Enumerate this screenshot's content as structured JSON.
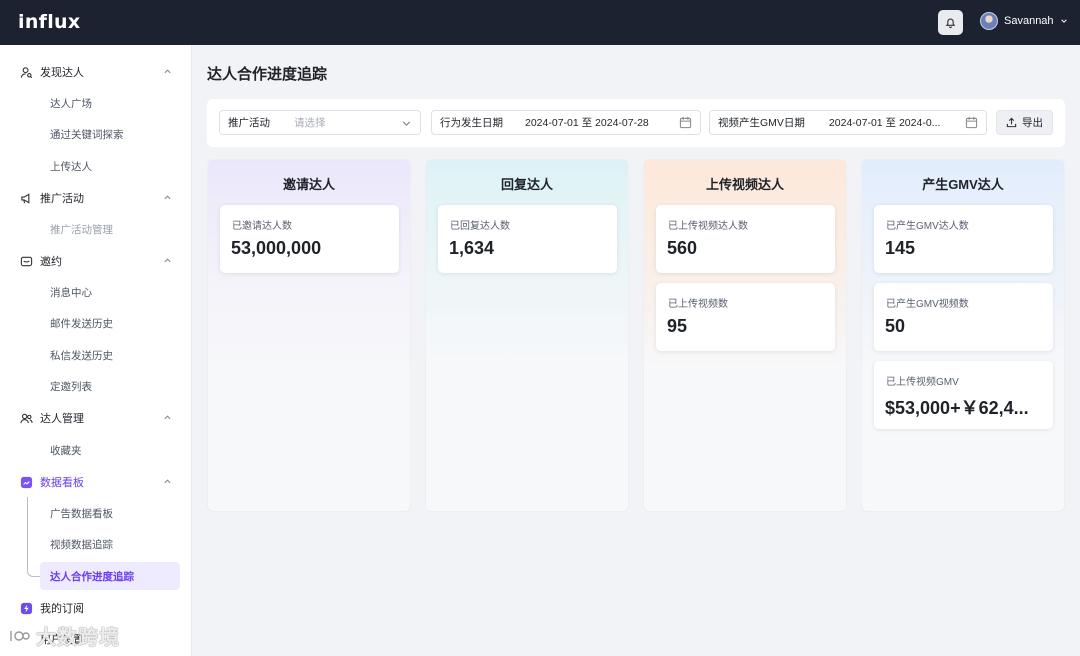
{
  "app": {
    "logo": "influx"
  },
  "header": {
    "user_name": "Savannah"
  },
  "sidebar": {
    "groups": [
      {
        "label": "发现达人",
        "items": [
          "达人广场",
          "通过关键词探索",
          "上传达人"
        ]
      },
      {
        "label": "推广活动",
        "items": [
          "推广活动管理"
        ]
      },
      {
        "label": "邀约",
        "items": [
          "消息中心",
          "邮件发送历史",
          "私信发送历史",
          "定邀列表"
        ]
      },
      {
        "label": "达人管理",
        "items": [
          "收藏夹"
        ]
      },
      {
        "label": "数据看板",
        "items": [
          "广告数据看板",
          "视频数据追踪",
          "达人合作进度追踪"
        ]
      },
      {
        "label": "我的订阅",
        "items": []
      },
      {
        "label": "用户设置",
        "items": []
      }
    ],
    "watermark": "大数跨境"
  },
  "main": {
    "title": "达人合作进度追踪",
    "filters": {
      "campaign_label": "推广活动",
      "campaign_placeholder": "请选择",
      "action_date_label": "行为发生日期",
      "action_date_value": "2024-07-01 至 2024-07-28",
      "gmv_date_label": "视频产生GMV日期",
      "gmv_date_value": "2024-07-01 至 2024-0...",
      "export_label": "导出"
    },
    "columns": [
      {
        "title": "邀请达人",
        "cards": [
          {
            "label": "已邀请达人数",
            "value": "53,000,000"
          }
        ]
      },
      {
        "title": "回复达人",
        "cards": [
          {
            "label": "已回复达人数",
            "value": "1,634"
          }
        ]
      },
      {
        "title": "上传视频达人",
        "cards": [
          {
            "label": "已上传视频达人数",
            "value": "560"
          },
          {
            "label": "已上传视频数",
            "value": "95"
          }
        ]
      },
      {
        "title": "产生GMV达人",
        "cards": [
          {
            "label": "已产生GMV达人数",
            "value": "145"
          },
          {
            "label": "已产生GMV视频数",
            "value": "50"
          },
          {
            "label": "已上传视频GMV",
            "value": "$53,000+￥62,4..."
          }
        ]
      }
    ]
  },
  "colors": {
    "accent": "#6a3df0",
    "topbar": "#1d2230"
  }
}
